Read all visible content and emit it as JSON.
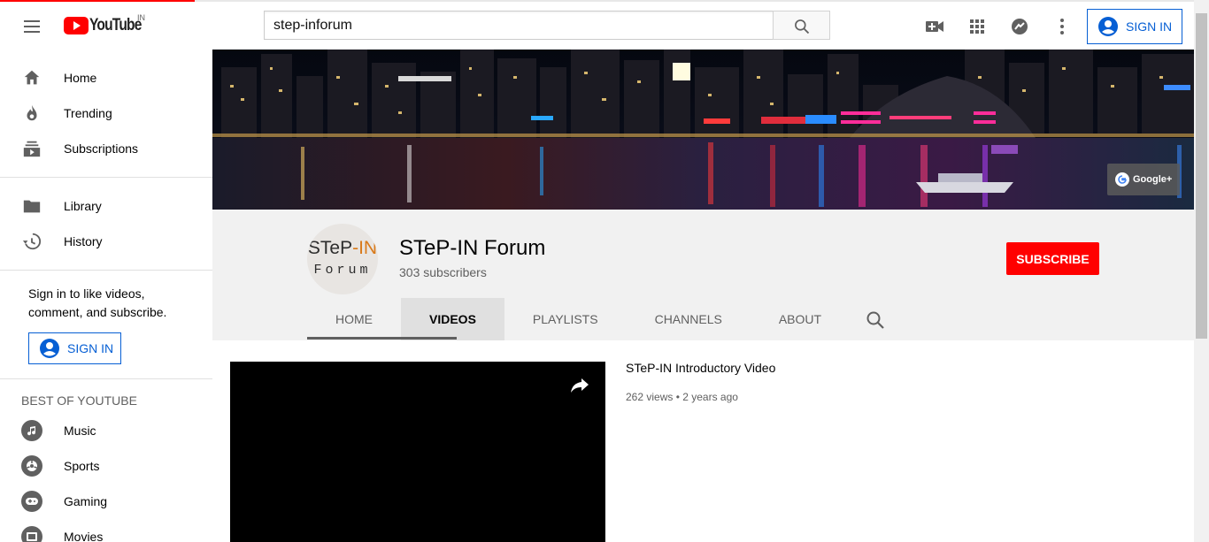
{
  "header": {
    "logo_text": "YouTube",
    "logo_country": "IN",
    "search_value": "step-inforum",
    "sign_in_label": "SIGN IN"
  },
  "sidebar": {
    "primary": [
      {
        "label": "Home",
        "icon": "home-icon"
      },
      {
        "label": "Trending",
        "icon": "flame-icon"
      },
      {
        "label": "Subscriptions",
        "icon": "subscriptions-icon"
      }
    ],
    "secondary": [
      {
        "label": "Library",
        "icon": "folder-icon"
      },
      {
        "label": "History",
        "icon": "history-icon"
      }
    ],
    "signin_prompt": "Sign in to like videos, comment, and subscribe.",
    "signin_button": "SIGN IN",
    "best_of_title": "BEST OF YOUTUBE",
    "best_of": [
      {
        "label": "Music",
        "icon": "music-icon"
      },
      {
        "label": "Sports",
        "icon": "sports-icon"
      },
      {
        "label": "Gaming",
        "icon": "gaming-icon"
      },
      {
        "label": "Movies",
        "icon": "movies-icon"
      }
    ]
  },
  "banner": {
    "gplus_label": "Google+"
  },
  "channel": {
    "avatar_line1_a": "STeP",
    "avatar_line1_b": "-IN",
    "avatar_line2": "Forum",
    "name": "STeP-IN Forum",
    "subscribers": "303 subscribers",
    "subscribe_label": "SUBSCRIBE",
    "tabs": [
      "HOME",
      "VIDEOS",
      "PLAYLISTS",
      "CHANNELS",
      "ABOUT"
    ],
    "active_tab": "VIDEOS"
  },
  "featured_video": {
    "title": "STeP-IN Introductory Video",
    "meta": "262 views • 2 years ago"
  },
  "colors": {
    "brand_red": "#ff0000",
    "link_blue": "#065fd4",
    "avatar_orange": "#d97a1a"
  }
}
